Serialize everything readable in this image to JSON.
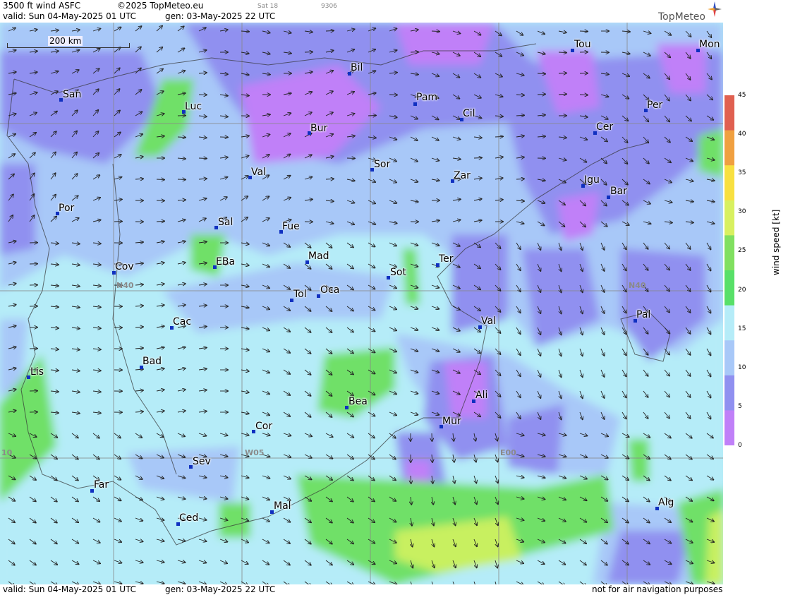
{
  "header": {
    "product": "3500 ft wind ASFC",
    "copyright": "©2025 TopMeteo.eu",
    "valid": "valid:  Sun  04-May-2025  01 UTC",
    "gen": "gen: 03-May-2025 22 UTC",
    "sat": "Sat 18",
    "code": "9306"
  },
  "footer": {
    "valid": "valid:  Sun  04-May-2025  01 UTC",
    "gen": "gen: 03-May-2025 22 UTC",
    "disclaimer": "not for air navigation purposes"
  },
  "logo": {
    "text": "TopMeteo"
  },
  "scalebar": {
    "label": "200 km"
  },
  "legend": {
    "title": "wind speed [kt]",
    "ticks": [
      "45",
      "40",
      "35",
      "30",
      "25",
      "20",
      "15",
      "10",
      "5",
      "0"
    ],
    "colors": [
      "#e06050",
      "#f0a040",
      "#f8e040",
      "#d8f060",
      "#80e060",
      "#58e068",
      "#b5ecf8",
      "#a8c8f8",
      "#9090f0",
      "#c080f8"
    ]
  },
  "grid_labels": {
    "n40_left": "N40",
    "n40_right": "N40",
    "w05": "W05",
    "e00": "E00",
    "w10": "10"
  },
  "cities": {
    "san": "San",
    "luc": "Luc",
    "bil": "Bil",
    "pam": "Pam",
    "cil": "Cil",
    "tou": "Tou",
    "mon": "Mon",
    "per": "Per",
    "bur": "Bur",
    "cer": "Cer",
    "val1": "Val",
    "sor": "Sor",
    "zar": "Zar",
    "igu": "Igu",
    "bar": "Bar",
    "por": "Por",
    "sal": "Sal",
    "fue": "Fue",
    "eba": "EBa",
    "mad": "Mad",
    "cov": "Cov",
    "ter": "Ter",
    "sot": "Sot",
    "tol": "Tol",
    "oca": "Oca",
    "pal": "Pal",
    "cac": "Cac",
    "val2": "Val",
    "bad": "Bad",
    "lis": "Lis",
    "ali": "Ali",
    "bea": "Bea",
    "mur": "Mur",
    "cor": "Cor",
    "sev": "Sev",
    "far": "Far",
    "mal": "Mal",
    "alg": "Alg",
    "ced": "Ced"
  }
}
